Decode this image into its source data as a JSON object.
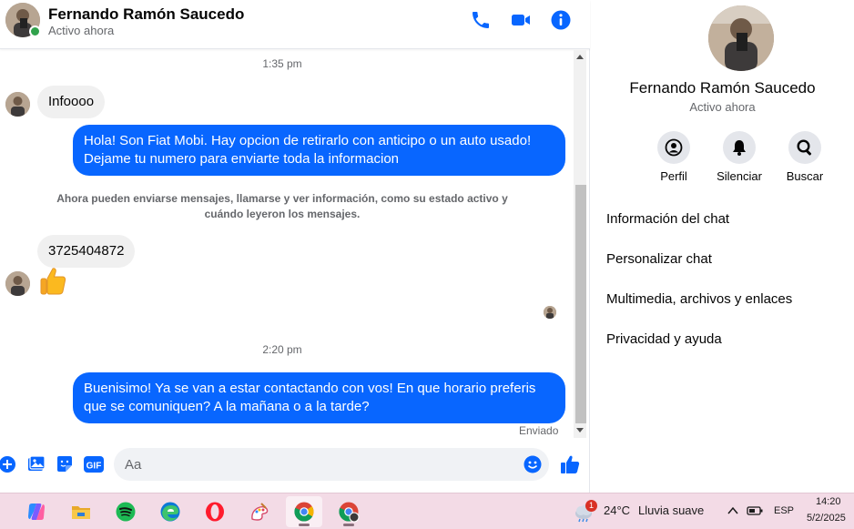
{
  "header": {
    "name": "Fernando Ramón Saucedo",
    "status": "Activo ahora",
    "icons": [
      "phone-icon",
      "video-icon",
      "info-icon"
    ]
  },
  "messages": {
    "time1": "1:35 pm",
    "in1": "Infoooo",
    "out1": "Hola! Son Fiat Mobi. Hay opcion de retirarlo con anticipo o un auto usado! Dejame tu numero para enviarte toda la informacion",
    "notice": "Ahora pueden enviarse mensajes, llamarse y ver información, como su estado activo y cuándo leyeron los mensajes.",
    "in2": "3725404872",
    "in3_emoji": "thumbs-up",
    "time2": "2:20 pm",
    "out2": "Buenisimo! Ya se van a estar contactando con vos! En que horario preferis que se comuniquen? A la mañana o a la tarde?",
    "sent": "Enviado"
  },
  "composer": {
    "placeholder": "Aa",
    "gif_label": "GIF",
    "icons": [
      "plus-icon",
      "image-icon",
      "sticker-icon",
      "gif-icon",
      "emoji-icon",
      "like-icon"
    ]
  },
  "info_panel": {
    "name": "Fernando Ramón Saucedo",
    "status": "Activo ahora",
    "actions": [
      {
        "label": "Perfil",
        "icon": "profile-icon"
      },
      {
        "label": "Silenciar",
        "icon": "bell-icon"
      },
      {
        "label": "Buscar",
        "icon": "search-icon"
      }
    ],
    "menu": [
      "Información del chat",
      "Personalizar chat",
      "Multimedia, archivos y enlaces",
      "Privacidad y ayuda"
    ]
  },
  "taskbar": {
    "apps": [
      "copilot",
      "file-explorer",
      "spotify",
      "edge",
      "opera",
      "paint",
      "chrome",
      "chrome-profile"
    ],
    "weather_badge": "1",
    "weather_temp": "24°C",
    "weather_desc": "Lluvia suave",
    "language": "ESP",
    "time": "14:20",
    "date": "5/2/2025"
  },
  "colors": {
    "accent": "#0866ff",
    "online": "#31a24c",
    "taskbar": "#f3dbe6"
  }
}
